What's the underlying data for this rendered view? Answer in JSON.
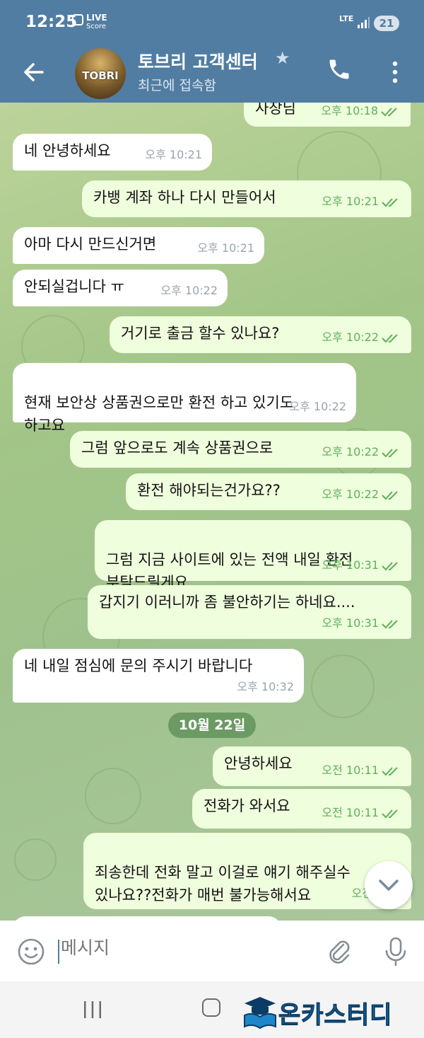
{
  "status_bar": {
    "time": "12:25",
    "live_badge": "LIVE",
    "live_sub": "Score",
    "network": "LTE",
    "battery": "21"
  },
  "header": {
    "title": "토브리 고객센터",
    "subtitle": "최근에 접속함",
    "avatar_text": "TOBRI"
  },
  "messages": [
    {
      "dir": "out",
      "text": "사장님",
      "time": "오후 10:18"
    },
    {
      "dir": "in",
      "text": "네 안녕하세요",
      "time": "오후 10:21"
    },
    {
      "dir": "out",
      "text": "카뱅 계좌 하나 다시 만들어서",
      "time": "오후 10:21"
    },
    {
      "dir": "in",
      "text": "아마 다시 만드신거면",
      "time": "오후 10:21"
    },
    {
      "dir": "in",
      "text": "안되실겁니다 ㅠ",
      "time": "오후 10:22"
    },
    {
      "dir": "out",
      "text": "거기로 출금 할수 있나요?",
      "time": "오후 10:22"
    },
    {
      "dir": "in",
      "text": "현재 보안상 상품권으로만 환전 하고 있기도\n하고요",
      "time": "오후 10:22"
    },
    {
      "dir": "out",
      "text": "그럼 앞으로도 계속 상품권으로",
      "time": "오후 10:22"
    },
    {
      "dir": "out",
      "text": "환전 해야되는건가요??",
      "time": "오후 10:22"
    },
    {
      "dir": "out",
      "text": "그럼 지금 사이트에 있는 전액 내일 환전\n부탁드릴게요",
      "time": "오후 10:31"
    },
    {
      "dir": "out",
      "text": "갑지기 이러니까 좀 불안하기는 하네요....",
      "time": "오후 10:31"
    },
    {
      "dir": "in",
      "text": "네 내일 점심에 문의 주시기 바랍니다",
      "time": "오후 10:32"
    },
    {
      "dir": "out",
      "text": "안녕하세요",
      "time": "오전 10:11"
    },
    {
      "dir": "out",
      "text": "전화가 와서요",
      "time": "오전 10:11"
    },
    {
      "dir": "out",
      "text": "죄송한데 전화 말고 이걸로 얘기 해주실수\n있나요??전화가 매번 불가능해서요",
      "time": "오전 10:1"
    }
  ],
  "date_divider": "10월 22일",
  "composer": {
    "placeholder": "메시지"
  },
  "watermark": "온카스터디",
  "colors": {
    "header": "#517da2",
    "incoming_bubble": "#ffffff",
    "outgoing_bubble": "#effedd",
    "read_ticks": "#5eb05a"
  }
}
